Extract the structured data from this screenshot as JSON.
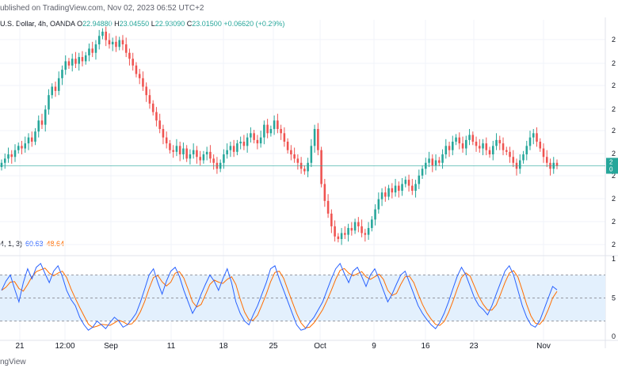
{
  "header": {
    "published_text": "ublished on TradingView.com, Nov 02, 2023 06:52 UTC+2"
  },
  "symbol": {
    "name_text": "U.S. Dollar, 4h, OANDA",
    "o_label": "O",
    "o_value": "22.94880",
    "h_label": "H",
    "h_value": "23.04550",
    "l_label": "L",
    "l_value": "22.93090",
    "c_label": "C",
    "c_value": "23.01500",
    "change": "+0.06620 (+0.29%)"
  },
  "stoch": {
    "params": "4, 1, 3)",
    "k_value": "60.63",
    "d_value": "48.64"
  },
  "footer": {
    "brand": "ngView"
  },
  "colors": {
    "up": "#26a69a",
    "down": "#ef5350",
    "k_line": "#2962ff",
    "d_line": "#ff6d00",
    "band_fill": "#e3f0fd",
    "price_line": "#26a69a"
  },
  "chart_data": [
    {
      "type": "candlestick",
      "title": "U.S. Dollar, 4h, OANDA",
      "x_tick_labels": [
        "21",
        "12:00",
        "Sep",
        "11",
        "18",
        "25",
        "Oct",
        "9",
        "16",
        "23",
        "Nov"
      ],
      "y_tick_labels": [
        "2",
        "2",
        "2",
        "2",
        "2",
        "2",
        "2",
        "2",
        "2",
        "2"
      ],
      "price_label": [
        "2",
        "0"
      ],
      "last_price": 23.015,
      "ylim": [
        22.0,
        24.6
      ],
      "close": [
        23.05,
        23.1,
        23.15,
        23.12,
        23.2,
        23.25,
        23.22,
        23.28,
        23.35,
        23.3,
        23.42,
        23.55,
        23.5,
        23.68,
        23.85,
        23.95,
        23.9,
        24.05,
        24.15,
        24.25,
        24.2,
        24.28,
        24.22,
        24.3,
        24.25,
        24.32,
        24.4,
        24.35,
        24.45,
        24.55,
        24.6,
        24.5,
        24.45,
        24.48,
        24.42,
        24.5,
        24.45,
        24.35,
        24.28,
        24.2,
        24.1,
        24.05,
        23.95,
        23.85,
        23.75,
        23.65,
        23.55,
        23.45,
        23.35,
        23.28,
        23.2,
        23.18,
        23.25,
        23.15,
        23.22,
        23.1,
        23.15,
        23.2,
        23.12,
        23.08,
        23.15,
        23.18,
        23.1,
        23.05,
        22.98,
        23.05,
        23.15,
        23.2,
        23.25,
        23.18,
        23.28,
        23.3,
        23.25,
        23.35,
        23.4,
        23.32,
        23.28,
        23.35,
        23.5,
        23.4,
        23.45,
        23.55,
        23.45,
        23.4,
        23.3,
        23.2,
        23.15,
        23.1,
        23.05,
        22.98,
        22.95,
        23.05,
        23.25,
        23.45,
        23.2,
        22.8,
        22.6,
        22.45,
        22.3,
        22.18,
        22.15,
        22.22,
        22.2,
        22.28,
        22.25,
        22.35,
        22.3,
        22.22,
        22.2,
        22.28,
        22.38,
        22.5,
        22.62,
        22.7,
        22.65,
        22.75,
        22.7,
        22.78,
        22.72,
        22.8,
        22.85,
        22.78,
        22.72,
        22.8,
        22.9,
        22.98,
        23.05,
        23.1,
        23.02,
        23.08,
        23.05,
        23.15,
        23.25,
        23.2,
        23.3,
        23.35,
        23.28,
        23.22,
        23.32,
        23.38,
        23.3,
        23.25,
        23.22,
        23.28,
        23.2,
        23.15,
        23.25,
        23.32,
        23.28,
        23.2,
        23.18,
        23.12,
        23.05,
        22.98,
        23.08,
        23.15,
        23.25,
        23.35,
        23.4,
        23.3,
        23.22,
        23.12,
        23.05,
        22.98,
        23.05,
        23.015
      ],
      "stoch_k": [
        60,
        72,
        80,
        62,
        45,
        70,
        88,
        75,
        90,
        95,
        82,
        70,
        85,
        92,
        78,
        60,
        48,
        40,
        25,
        15,
        8,
        12,
        20,
        15,
        10,
        18,
        25,
        20,
        12,
        15,
        22,
        30,
        45,
        62,
        80,
        88,
        70,
        55,
        72,
        85,
        90,
        78,
        60,
        45,
        30,
        40,
        55,
        68,
        80,
        72,
        60,
        75,
        88,
        70,
        45,
        30,
        20,
        15,
        28,
        40,
        55,
        70,
        88,
        92,
        75,
        60,
        45,
        30,
        15,
        8,
        10,
        18,
        25,
        35,
        45,
        60,
        75,
        88,
        95,
        82,
        70,
        85,
        90,
        78,
        65,
        80,
        88,
        75,
        60,
        45,
        55,
        68,
        80,
        85,
        70,
        55,
        40,
        30,
        22,
        15,
        10,
        18,
        30,
        45,
        62,
        78,
        90,
        80,
        65,
        50,
        40,
        35,
        28,
        40,
        55,
        70,
        85,
        92,
        80,
        60,
        40,
        25,
        15,
        12,
        20,
        35,
        50,
        65,
        60.63
      ]
    }
  ]
}
